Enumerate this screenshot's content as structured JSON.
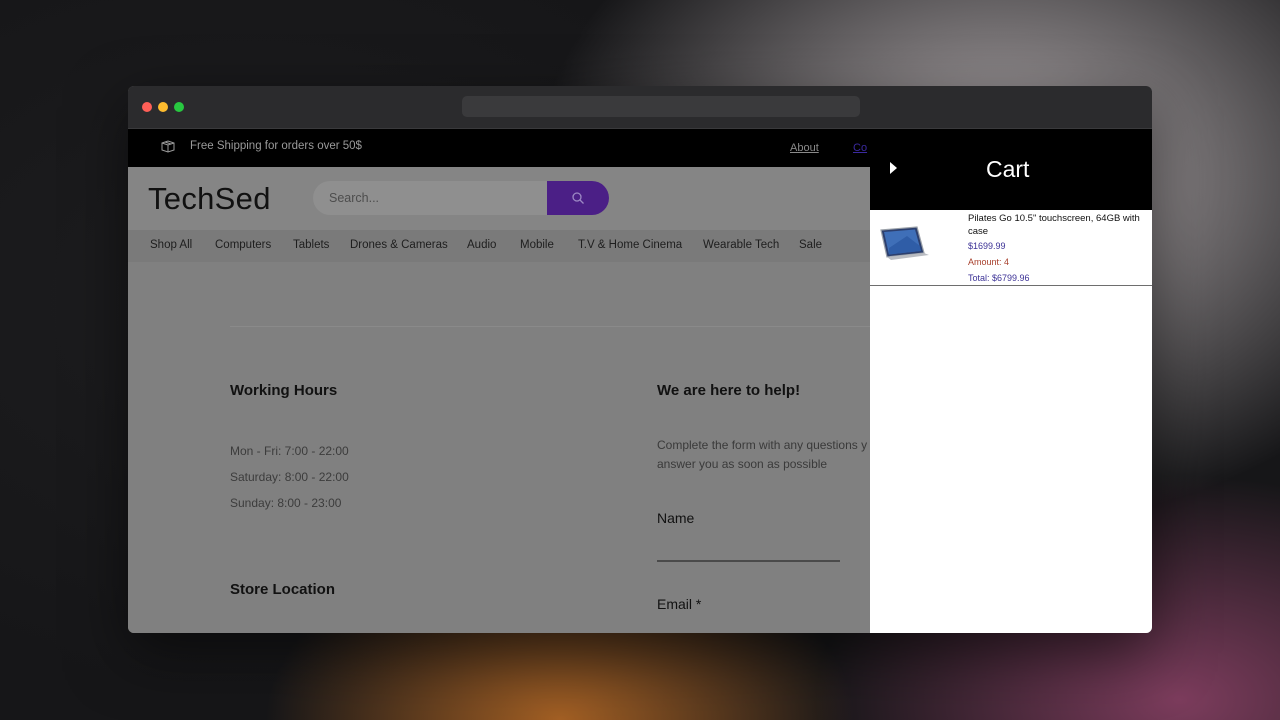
{
  "topbar": {
    "shipping_text": "Free Shipping for orders over 50$",
    "about_link": "About",
    "contact_link": "Co"
  },
  "header": {
    "logo": "TechSed",
    "search_placeholder": "Search..."
  },
  "nav": {
    "items": [
      "Shop All",
      "Computers",
      "Tablets",
      "Drones & Cameras",
      "Audio",
      "Mobile",
      "T.V & Home Cinema",
      "Wearable Tech",
      "Sale"
    ]
  },
  "working_hours": {
    "title": "Working Hours",
    "lines": [
      "Mon - Fri: 7:00 - 22:00",
      "Saturday: 8:00 - 22:00",
      "Sunday: 8:00 - 23:00"
    ]
  },
  "store_location": {
    "title": "Store Location"
  },
  "help": {
    "title": "We are here to help!",
    "description_line1": "Complete the form with any questions y",
    "description_line2": "answer you as soon as possible",
    "name_label": "Name",
    "email_label": "Email *"
  },
  "cart": {
    "title": "Cart",
    "items": [
      {
        "name": "Pilates Go 10.5\" touchscreen, 64GB with case",
        "price": "$1699.99",
        "amount": "Amount: 4",
        "total": "Total: $6799.96"
      }
    ]
  },
  "colors": {
    "accent": "#4b1f86",
    "cart_price": "#3c3296",
    "cart_amount": "#a8402c"
  }
}
